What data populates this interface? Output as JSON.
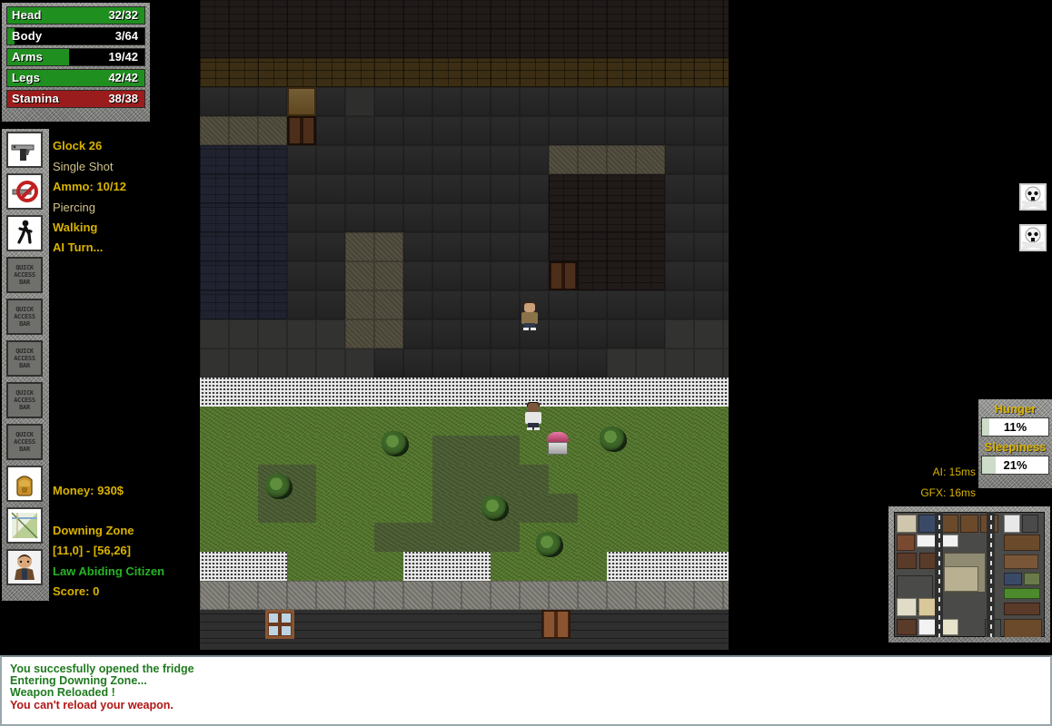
{
  "vitals": {
    "bars": [
      {
        "name": "Head",
        "value": "32/32",
        "pct": 100,
        "color": "green"
      },
      {
        "name": "Body",
        "value": "3/64",
        "pct": 5,
        "color": "green"
      },
      {
        "name": "Arms",
        "value": "19/42",
        "pct": 45,
        "color": "green"
      },
      {
        "name": "Legs",
        "value": "42/42",
        "pct": 100,
        "color": "green"
      },
      {
        "name": "Stamina",
        "value": "38/38",
        "pct": 100,
        "color": "red"
      }
    ]
  },
  "left_panel": {
    "weapon_name": "Glock 26",
    "fire_mode": "Single Shot",
    "ammo": "Ammo: 10/12",
    "ammo_type": "Piercing",
    "movement_mode": "Walking",
    "turn_status": "AI Turn...",
    "money": "Money: 930$",
    "zone_name": "Downing Zone",
    "zone_coords": "[11,0] - [56,26]",
    "reputation": "Law Abiding Citizen",
    "score": "Score: 0",
    "quick_access_label": [
      "QUICK",
      "ACCESS",
      "BAR"
    ],
    "quick_access_count": 5,
    "icons": {
      "weapon": "pistol-icon",
      "ammo": "ammo-icon",
      "movement": "walking-icon",
      "money": "backpack-icon",
      "zone": "map-icon",
      "reputation": "citizen-portrait-icon"
    }
  },
  "right_panel": {
    "enemy_markers": [
      "skull-icon",
      "skull-icon"
    ],
    "hunger_label": "Hunger",
    "hunger_value": "11%",
    "hunger_pct": 11,
    "sleepiness_label": "Sleepiness",
    "sleepiness_value": "21%",
    "sleepiness_pct": 21,
    "ai_time": "AI: 15ms",
    "gfx_time": "GFX: 16ms"
  },
  "message_log": {
    "lines": [
      {
        "text": "You succesfully opened the fridge",
        "type": "good"
      },
      {
        "text": "Entering Downing Zone...",
        "type": "good"
      },
      {
        "text": "Weapon Reloaded !",
        "type": "good"
      },
      {
        "text": "You can't reload your weapon.",
        "type": "bad"
      }
    ]
  },
  "colors": {
    "health_green": "#1f8f1f",
    "stamina_red": "#9b1c1c",
    "gold_text": "#d9b300",
    "green_text": "#25b425",
    "log_good": "#1f7a1f",
    "log_bad": "#b31616",
    "cursor_red": "#cc2222"
  },
  "map": {
    "cursor_label": "target-cursor",
    "player_label": "player-character",
    "npc_label": "npc-character",
    "stand_label": "food-stand"
  }
}
